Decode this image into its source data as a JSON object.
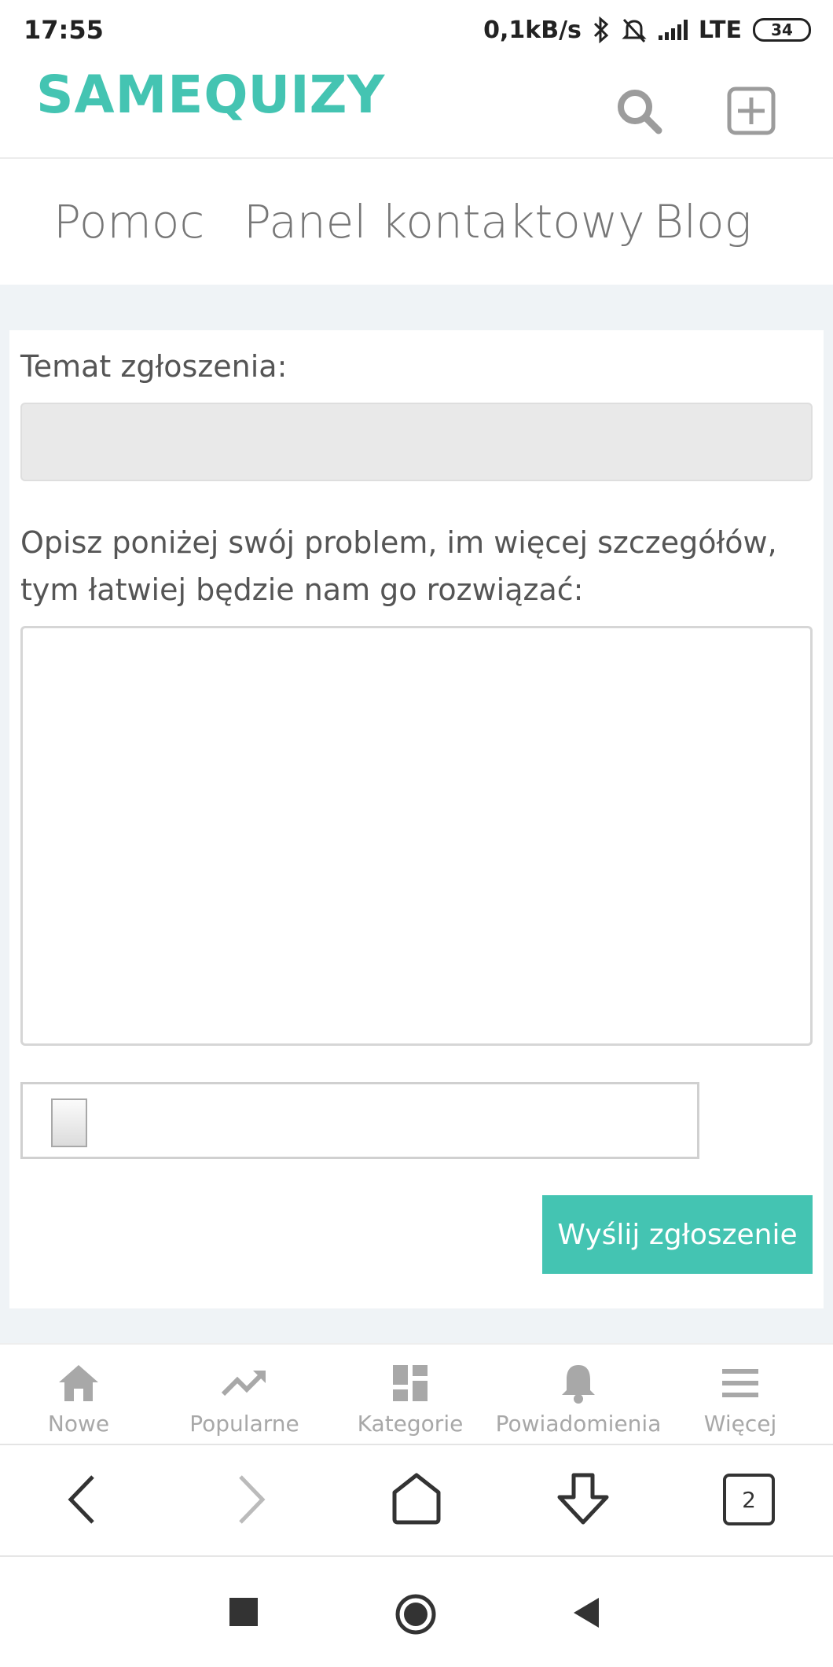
{
  "status_bar": {
    "time": "17:55",
    "speed": "0,1kB/s",
    "network": "LTE",
    "battery": "34"
  },
  "header": {
    "logo_small": "SAME",
    "logo_big": "QUIZY",
    "icons": [
      "search-icon",
      "plus-square-icon"
    ]
  },
  "nav": {
    "items": [
      "Pomoc",
      "Panel kontaktowy",
      "Blog"
    ]
  },
  "form": {
    "subject_label": "Temat zgłoszenia:",
    "subject_value": "",
    "description_label_line1": "Opisz poniżej swój problem, im więcej szczegółów,",
    "description_label_line2": "tym łatwiej będzie nam go rozwiązać:",
    "description_value": "",
    "submit_label": "Wyślij zgłoszenie"
  },
  "bottom_tabs": [
    {
      "label": "Nowe",
      "icon": "home-icon"
    },
    {
      "label": "Popularne",
      "icon": "trending-icon"
    },
    {
      "label": "Kategorie",
      "icon": "grid-icon"
    },
    {
      "label": "Powiadomienia",
      "icon": "bell-icon"
    },
    {
      "label": "Więcej",
      "icon": "menu-icon"
    }
  ],
  "browser": {
    "tab_count": "2"
  },
  "colors": {
    "accent": "#44c4b2",
    "background": "#eff3f6"
  }
}
